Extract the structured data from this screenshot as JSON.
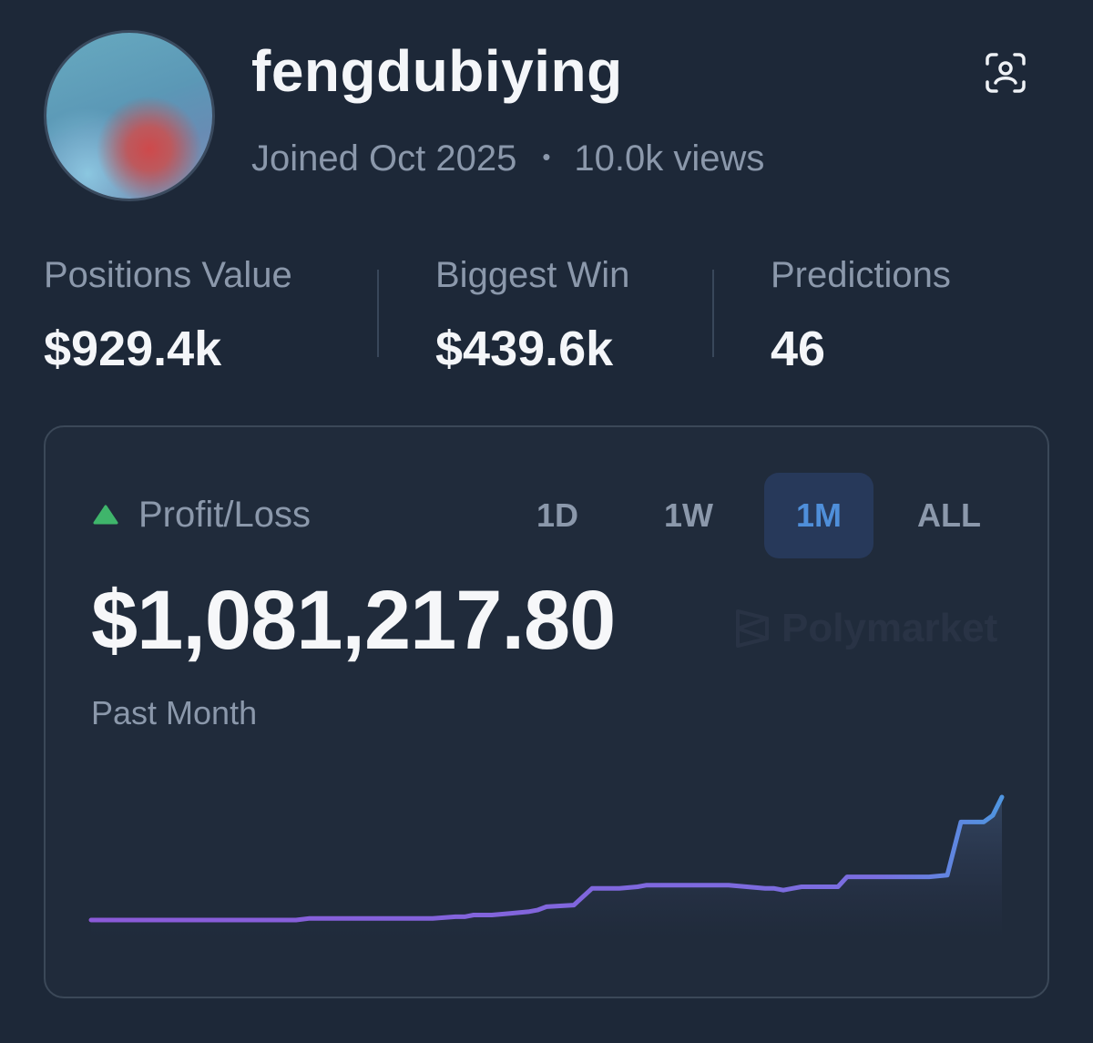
{
  "profile": {
    "username": "fengdubiying",
    "joined": "Joined Oct 2025",
    "separator": "•",
    "views": "10.0k views"
  },
  "stats": [
    {
      "label": "Positions Value",
      "value": "$929.4k"
    },
    {
      "label": "Biggest Win",
      "value": "$439.6k"
    },
    {
      "label": "Predictions",
      "value": "46"
    }
  ],
  "pnl": {
    "label": "Profit/Loss",
    "value": "$1,081,217.80",
    "period": "Past Month",
    "trend": "up",
    "tabs": [
      "1D",
      "1W",
      "1M",
      "ALL"
    ],
    "active_tab": "1M",
    "watermark": "Polymarket"
  },
  "colors": {
    "background": "#1d2838",
    "card": "#202b3b",
    "accent": "#4f8fda",
    "positive": "#3fb56b",
    "line_start": "#8b5ad8",
    "line_end": "#4f95e0"
  },
  "icons": {
    "scan": "scan-profile-icon",
    "trend": "triangle-up-icon",
    "logo": "polymarket-logo-icon"
  },
  "chart_data": {
    "type": "area",
    "x_label": "",
    "y_label": "",
    "points": [
      [
        0,
        0
      ],
      [
        4,
        0
      ],
      [
        8,
        0
      ],
      [
        12,
        0
      ],
      [
        16,
        0
      ],
      [
        20,
        0
      ],
      [
        22.5,
        0
      ],
      [
        24,
        0.01
      ],
      [
        26,
        0.01
      ],
      [
        28,
        0.01
      ],
      [
        30,
        0.01
      ],
      [
        32,
        0.01
      ],
      [
        34,
        0.01
      ],
      [
        36,
        0.01
      ],
      [
        37.5,
        0.01
      ],
      [
        40,
        0.02
      ],
      [
        41,
        0.02
      ],
      [
        42,
        0.03
      ],
      [
        44,
        0.03
      ],
      [
        46,
        0.04
      ],
      [
        48,
        0.05
      ],
      [
        49,
        0.06
      ],
      [
        50,
        0.08
      ],
      [
        53,
        0.09
      ],
      [
        55,
        0.19
      ],
      [
        56,
        0.19
      ],
      [
        58,
        0.19
      ],
      [
        60,
        0.2
      ],
      [
        61,
        0.21
      ],
      [
        62,
        0.21
      ],
      [
        64,
        0.21
      ],
      [
        66,
        0.21
      ],
      [
        68,
        0.21
      ],
      [
        70,
        0.21
      ],
      [
        72,
        0.2
      ],
      [
        74,
        0.19
      ],
      [
        75,
        0.19
      ],
      [
        76,
        0.18
      ],
      [
        77,
        0.19
      ],
      [
        78,
        0.2
      ],
      [
        80,
        0.2
      ],
      [
        82,
        0.2
      ],
      [
        83,
        0.26
      ],
      [
        85,
        0.26
      ],
      [
        88,
        0.26
      ],
      [
        90,
        0.26
      ],
      [
        92,
        0.26
      ],
      [
        94,
        0.27
      ],
      [
        95.5,
        0.59
      ],
      [
        96,
        0.59
      ],
      [
        98,
        0.59
      ],
      [
        99,
        0.63
      ],
      [
        100,
        0.74
      ]
    ]
  }
}
